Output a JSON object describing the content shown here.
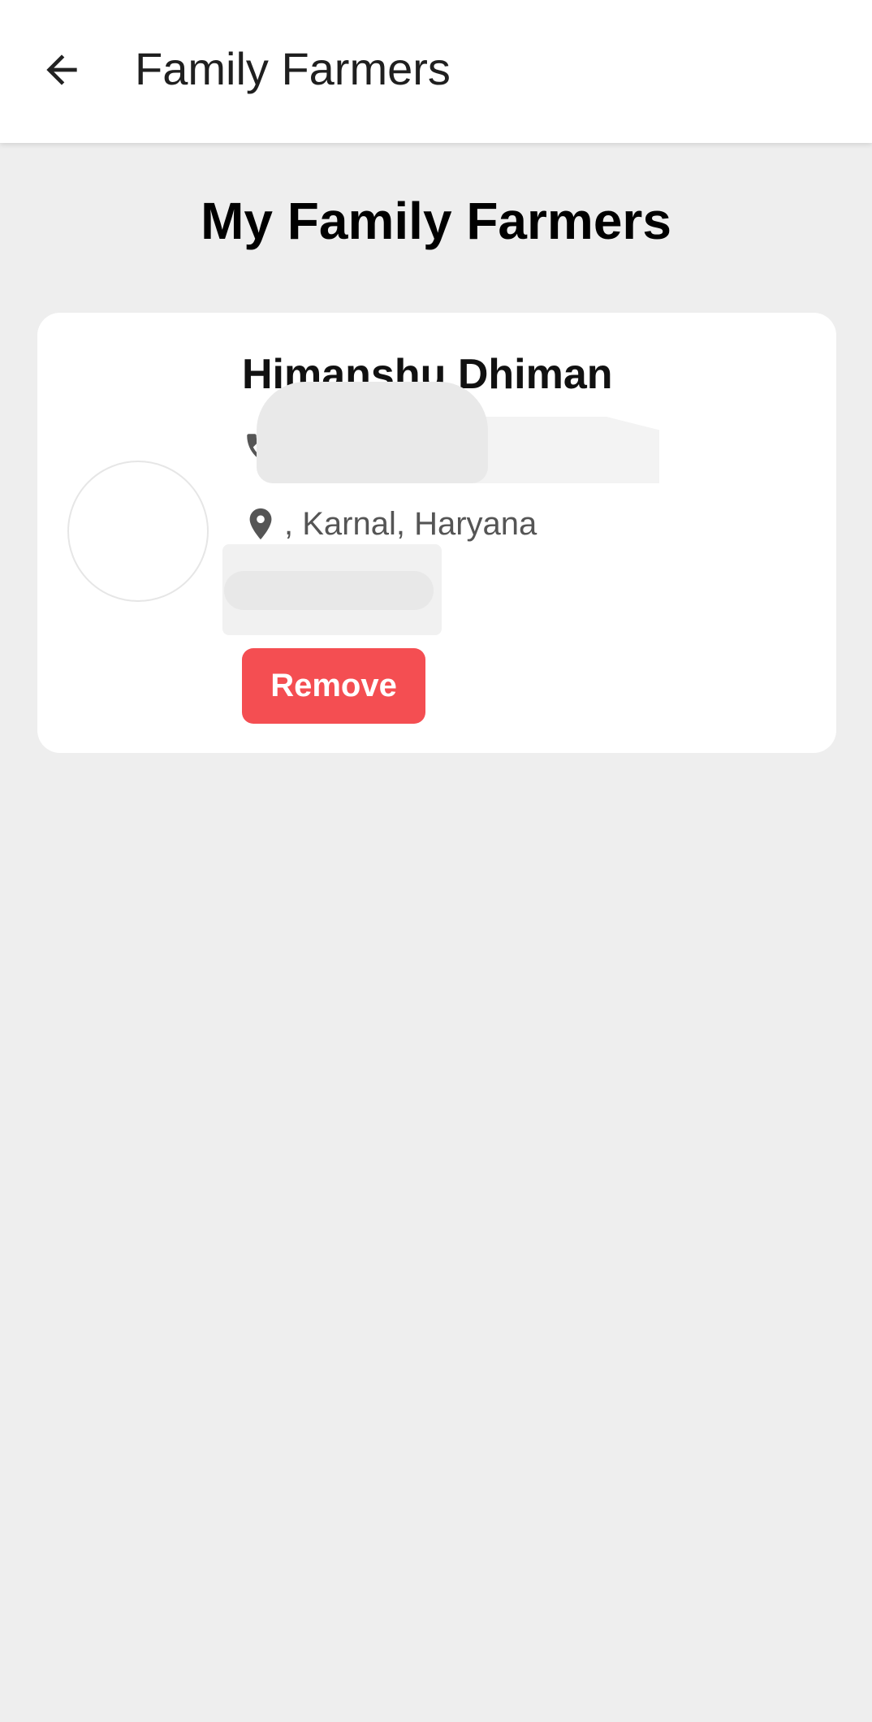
{
  "app_bar": {
    "title": "Family Farmers",
    "back_icon": "arrow-left-icon"
  },
  "page": {
    "heading": "My Family Farmers"
  },
  "farmers": [
    {
      "name": "Himanshu Dhiman",
      "phone_icon": "phone-icon",
      "location_icon": "location-pin-icon",
      "location": ", Karnal, Haryana",
      "remove_label": "Remove"
    }
  ],
  "colors": {
    "accent_red": "#f44e52",
    "background": "#eeeeee",
    "card": "#ffffff",
    "icon_gray": "#555555"
  }
}
